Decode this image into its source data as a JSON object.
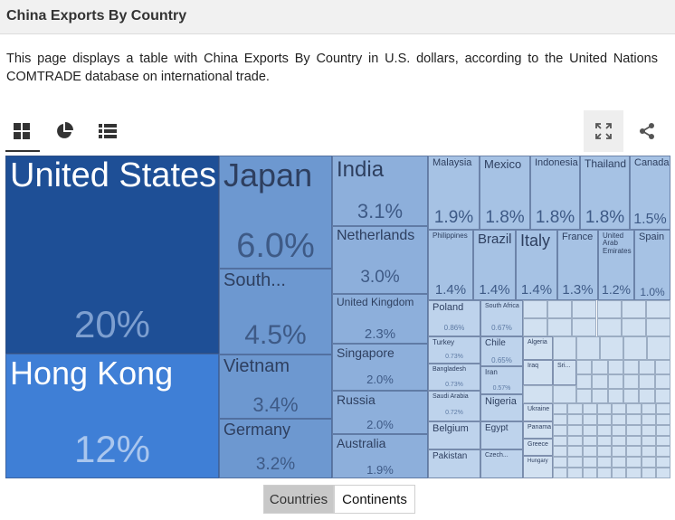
{
  "page": {
    "title": "China Exports By Country",
    "description": "This page displays a table with China Exports By Country in U.S. dollars, according to the United Nations COMTRADE database on international trade."
  },
  "toolbar": {
    "views": [
      {
        "icon": "treemap-grid-icon",
        "active": true
      },
      {
        "icon": "pie-chart-icon",
        "active": false
      },
      {
        "icon": "list-view-icon",
        "active": false
      }
    ],
    "expand_icon": "expand-icon",
    "share_icon": "share-icon"
  },
  "toggle": {
    "countries_label": "Countries",
    "continents_label": "Continents",
    "selected": "Countries"
  },
  "colors": {
    "level1": "#1e4f96",
    "level2": "#3f7fd6",
    "level3": "#6d98d0",
    "level4": "#8dafdb",
    "level5": "#a6c2e4",
    "level6": "#bed3ec",
    "level7": "#d2e1f1"
  },
  "chart_data": {
    "type": "treemap",
    "title": "China Exports By Country",
    "unit": "%",
    "items": [
      {
        "name": "United States",
        "value": 20,
        "label": "20%"
      },
      {
        "name": "Hong Kong",
        "value": 12,
        "label": "12%"
      },
      {
        "name": "Japan",
        "value": 6.0,
        "label": "6.0%"
      },
      {
        "name": "South...",
        "value": 4.5,
        "label": "4.5%"
      },
      {
        "name": "Vietnam",
        "value": 3.4,
        "label": "3.4%"
      },
      {
        "name": "Germany",
        "value": 3.2,
        "label": "3.2%"
      },
      {
        "name": "India",
        "value": 3.1,
        "label": "3.1%"
      },
      {
        "name": "Netherlands",
        "value": 3.0,
        "label": "3.0%"
      },
      {
        "name": "United Kingdom",
        "value": 2.3,
        "label": "2.3%"
      },
      {
        "name": "Singapore",
        "value": 2.0,
        "label": "2.0%"
      },
      {
        "name": "Russia",
        "value": 2.0,
        "label": "2.0%"
      },
      {
        "name": "Australia",
        "value": 1.9,
        "label": "1.9%"
      },
      {
        "name": "Malaysia",
        "value": 1.9,
        "label": "1.9%"
      },
      {
        "name": "Mexico",
        "value": 1.8,
        "label": "1.8%"
      },
      {
        "name": "Indonesia",
        "value": 1.8,
        "label": "1.8%"
      },
      {
        "name": "Thailand",
        "value": 1.8,
        "label": "1.8%"
      },
      {
        "name": "Canada",
        "value": 1.5,
        "label": "1.5%"
      },
      {
        "name": "Philippines",
        "value": 1.4,
        "label": "1.4%"
      },
      {
        "name": "Brazil",
        "value": 1.4,
        "label": "1.4%"
      },
      {
        "name": "Italy",
        "value": 1.4,
        "label": "1.4%"
      },
      {
        "name": "France",
        "value": 1.3,
        "label": "1.3%"
      },
      {
        "name": "United Arab Emirates",
        "value": 1.2,
        "label": "1.2%"
      },
      {
        "name": "Spain",
        "value": 1.0,
        "label": "1.0%"
      },
      {
        "name": "Poland",
        "value": 0.86,
        "label": "0.86%"
      },
      {
        "name": "South Africa",
        "value": 0.67,
        "label": "0.67%"
      },
      {
        "name": "Turkey",
        "value": 0.73,
        "label": "0.73%"
      },
      {
        "name": "Chile",
        "value": 0.65,
        "label": "0.65%"
      },
      {
        "name": "Bangladesh",
        "value": 0.73,
        "label": "0.73%"
      },
      {
        "name": "Iran",
        "value": 0.57,
        "label": "0.57%"
      },
      {
        "name": "Saudi Arabia",
        "value": 0.72,
        "label": "0.72%"
      },
      {
        "name": "Nigeria",
        "value": 0.6,
        "label": ""
      },
      {
        "name": "Belgium",
        "value": 0.6,
        "label": ""
      },
      {
        "name": "Egypt",
        "value": 0.55,
        "label": ""
      },
      {
        "name": "Pakistan",
        "value": 0.55,
        "label": ""
      },
      {
        "name": "Czech...",
        "value": 0.5,
        "label": ""
      },
      {
        "name": "Algeria",
        "value": 0.45,
        "label": ""
      },
      {
        "name": "Iraq",
        "value": 0.42,
        "label": ""
      },
      {
        "name": "Sri...",
        "value": 0.4,
        "label": ""
      },
      {
        "name": "Ukraine",
        "value": 0.35,
        "label": ""
      },
      {
        "name": "Panama",
        "value": 0.33,
        "label": ""
      },
      {
        "name": "Greece",
        "value": 0.32,
        "label": ""
      },
      {
        "name": "Hungary",
        "value": 0.3,
        "label": ""
      }
    ]
  }
}
